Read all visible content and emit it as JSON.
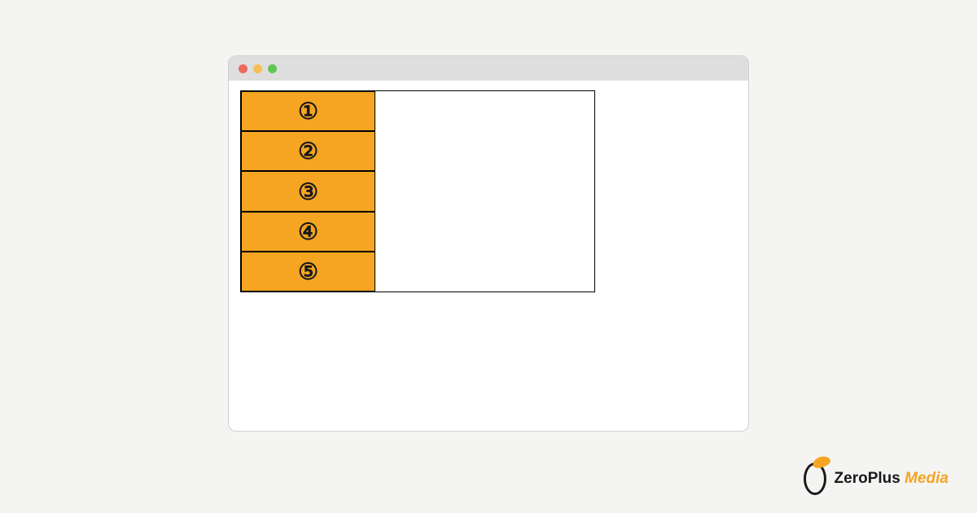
{
  "items": [
    "①",
    "②",
    "③",
    "④",
    "⑤"
  ],
  "logo": {
    "brand": "ZeroPlus",
    "suffix": "Media"
  },
  "colors": {
    "item_bg": "#f5a521",
    "body_bg": "#f4f4f2"
  }
}
